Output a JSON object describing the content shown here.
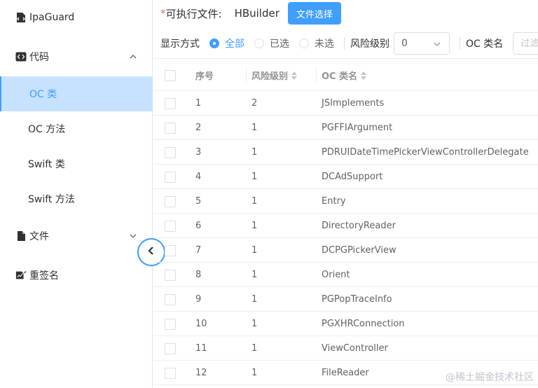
{
  "sidebar": {
    "app_name": "IpaGuard",
    "code_label": "代码",
    "sub_items": [
      "OC 类",
      "OC 方法",
      "Swift 类",
      "Swift 方法"
    ],
    "file_label": "文件",
    "rename_label": "重签名"
  },
  "header": {
    "required_mark": "*",
    "exec_label": "可执行文件:",
    "exec_value": "HBuilder",
    "choose_button": "文件选择"
  },
  "filter": {
    "display_label": "显示方式",
    "options": [
      "全部",
      "已选",
      "未选"
    ],
    "selected_option": "全部",
    "risk_label": "风险级别",
    "risk_value": "0",
    "oc_name_label": "OC 类名",
    "oc_name_placeholder": "过滤"
  },
  "table": {
    "headers": [
      "序号",
      "风险级别",
      "OC 类名"
    ],
    "rows": [
      [
        "1",
        "2",
        "JSImplements"
      ],
      [
        "2",
        "1",
        "PGFFIArgument"
      ],
      [
        "3",
        "1",
        "PDRUIDateTimePickerViewControllerDelegate"
      ],
      [
        "4",
        "1",
        "DCAdSupport"
      ],
      [
        "5",
        "1",
        "Entry"
      ],
      [
        "6",
        "1",
        "DirectoryReader"
      ],
      [
        "7",
        "1",
        "DCPGPickerView"
      ],
      [
        "8",
        "1",
        "Orient"
      ],
      [
        "9",
        "1",
        "PGPopTraceInfo"
      ],
      [
        "10",
        "1",
        "PGXHRConnection"
      ],
      [
        "11",
        "1",
        "ViewController"
      ],
      [
        "12",
        "1",
        "FileReader"
      ]
    ]
  },
  "watermark": "@稀土掘金技术社区",
  "colors": {
    "primary": "#409eff",
    "active_bg": "#c6e2ff",
    "border": "#ebeef5"
  }
}
